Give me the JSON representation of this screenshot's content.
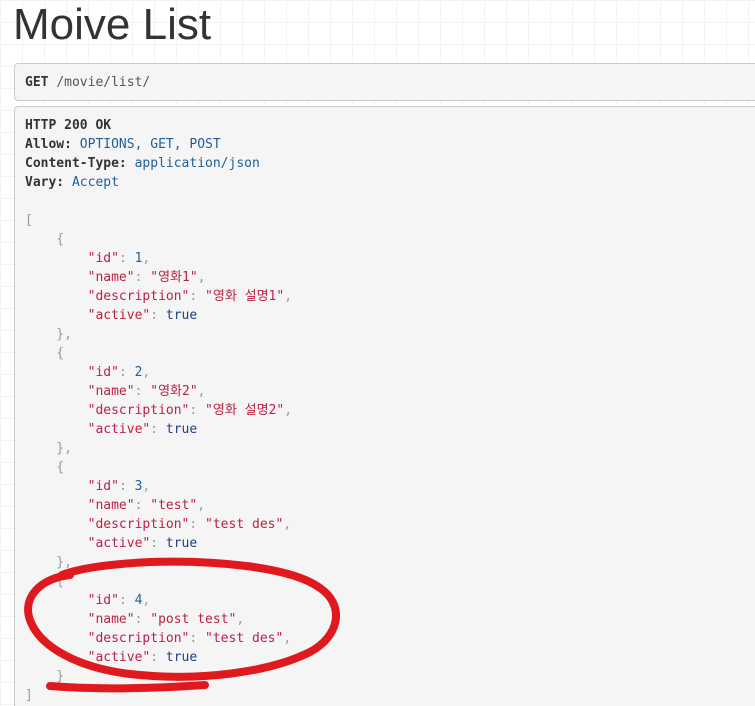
{
  "page": {
    "title": "Moive List"
  },
  "request": {
    "method": "GET",
    "path": "/movie/list/"
  },
  "response": {
    "status": "HTTP 200 OK",
    "headers": [
      {
        "name": "Allow:",
        "value": "OPTIONS, GET, POST"
      },
      {
        "name": "Content-Type:",
        "value": "application/json"
      },
      {
        "name": "Vary:",
        "value": "Accept"
      }
    ],
    "items": [
      {
        "id": "1",
        "name": "\"영화1\"",
        "description": "\"영화 설명1\"",
        "active": "true"
      },
      {
        "id": "2",
        "name": "\"영화2\"",
        "description": "\"영화 설명2\"",
        "active": "true"
      },
      {
        "id": "3",
        "name": "\"test\"",
        "description": "\"test des\"",
        "active": "true"
      },
      {
        "id": "4",
        "name": "\"post test\"",
        "description": "\"test des\"",
        "active": "true"
      }
    ],
    "keys": {
      "id": "\"id\"",
      "name": "\"name\"",
      "description": "\"description\"",
      "active": "\"active\""
    }
  },
  "annotation": {
    "color": "#e0191e"
  }
}
